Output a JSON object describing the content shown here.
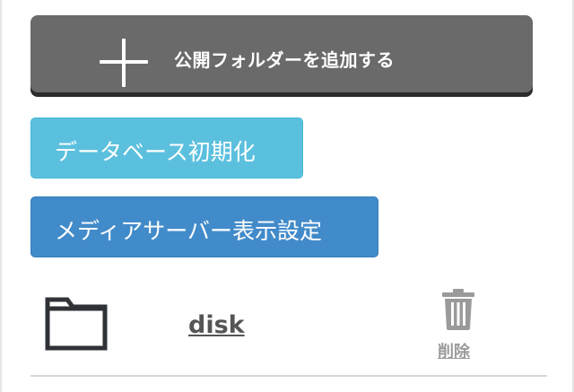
{
  "actions": {
    "add_public_folder_label": "公開フォルダーを追加する",
    "init_database_label": "データベース初期化",
    "media_server_settings_label": "メディアサーバー表示設定"
  },
  "folders": [
    {
      "name": "disk",
      "delete_label": "削除",
      "icon": "folder-icon"
    }
  ],
  "colors": {
    "add_button_bg": "#6a6a6a",
    "info_button_bg": "#5bc0de",
    "primary_button_bg": "#428bca",
    "icon_dark": "#2f3338",
    "muted_gray": "#9a9a9a"
  }
}
